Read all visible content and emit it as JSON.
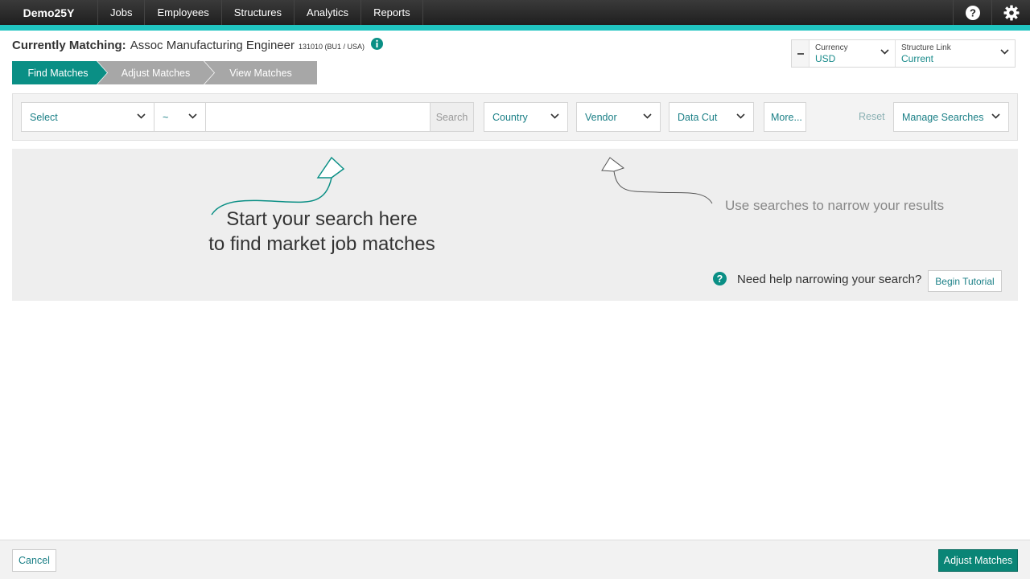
{
  "nav": {
    "brand": "Demo25Y",
    "items": [
      "Jobs",
      "Employees",
      "Structures",
      "Analytics",
      "Reports"
    ]
  },
  "header": {
    "label": "Currently Matching:",
    "job_title": "Assoc Manufacturing Engineer",
    "job_code": "131010 (BU1 / USA)"
  },
  "steps": [
    "Find Matches",
    "Adjust Matches",
    "View Matches"
  ],
  "controls": {
    "currency_label": "Currency",
    "currency_value": "USD",
    "structure_label": "Structure Link",
    "structure_value": "Current"
  },
  "search": {
    "select": "Select",
    "operator": "~",
    "query": "",
    "search_button": "Search",
    "country": "Country",
    "vendor": "Vendor",
    "datacut": "Data Cut",
    "more": "More...",
    "reset": "Reset",
    "manage": "Manage Searches"
  },
  "hint": {
    "line1": "Start your search here",
    "line2": "to find market job matches",
    "side": "Use searches to narrow your results",
    "help": "Need help narrowing your search?",
    "tutorial": "Begin Tutorial"
  },
  "footer": {
    "cancel": "Cancel",
    "adjust": "Adjust Matches"
  },
  "colors": {
    "accent": "#20c4c0",
    "primary": "#0a8f85",
    "link": "#1a7f86"
  }
}
